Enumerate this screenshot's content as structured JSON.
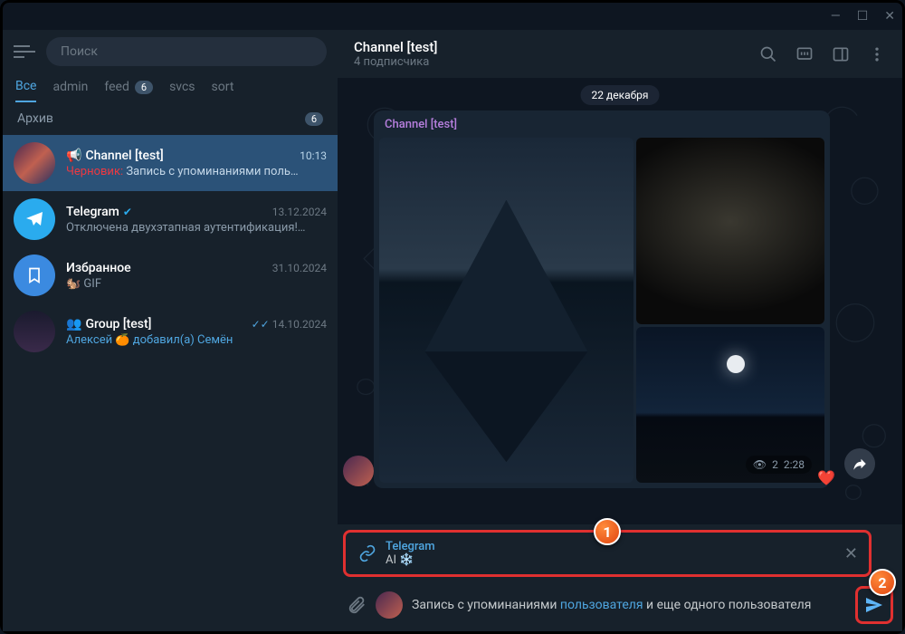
{
  "titlebar": {
    "min": "—",
    "max": "☐",
    "close": "✕"
  },
  "search": {
    "placeholder": "Поиск"
  },
  "tabs": [
    {
      "label": "Все",
      "active": true
    },
    {
      "label": "admin"
    },
    {
      "label": "feed",
      "badge": "6"
    },
    {
      "label": "svcs"
    },
    {
      "label": "sort"
    }
  ],
  "archive": {
    "label": "Архив",
    "badge": "6"
  },
  "chats": [
    {
      "name": "Channel [test]",
      "time": "10:13",
      "prefix": "Черновик: ",
      "msg": "Запись с упоминаниями поль…",
      "icon": "📢",
      "sel": true,
      "av": "av-sunset"
    },
    {
      "name": "Telegram",
      "time": "13.12.2024",
      "msg": "Отключена двухэтапная аутентификация!…",
      "verified": true,
      "av": "av-tg",
      "avicon": "tg"
    },
    {
      "name": "Избранное",
      "time": "31.10.2024",
      "msg": "GIF",
      "emoji": "🐿️",
      "av": "av-fav",
      "avicon": "bm"
    },
    {
      "name": "Group [test]",
      "time": "14.10.2024",
      "msg_parts": {
        "a": "Алексей ",
        "e": "🍊",
        "b": " добавил(а) ",
        "c": "Семён"
      },
      "groupicon": true,
      "checks": "✓✓",
      "av": "av-grp"
    }
  ],
  "header": {
    "title": "Channel [test]",
    "sub": "4 подписчика"
  },
  "date": "22 декабря",
  "msgname": "Channel [test]",
  "meta": {
    "views": "2",
    "time": "2:28",
    "eye": "👁"
  },
  "link": {
    "title": "Telegram",
    "text": "AI"
  },
  "compose": {
    "t1": "Запись с упоминаниями ",
    "mention": "пользователя",
    "t2": " и еще одного пользователя"
  },
  "callouts": {
    "c1": "1",
    "c2": "2"
  }
}
